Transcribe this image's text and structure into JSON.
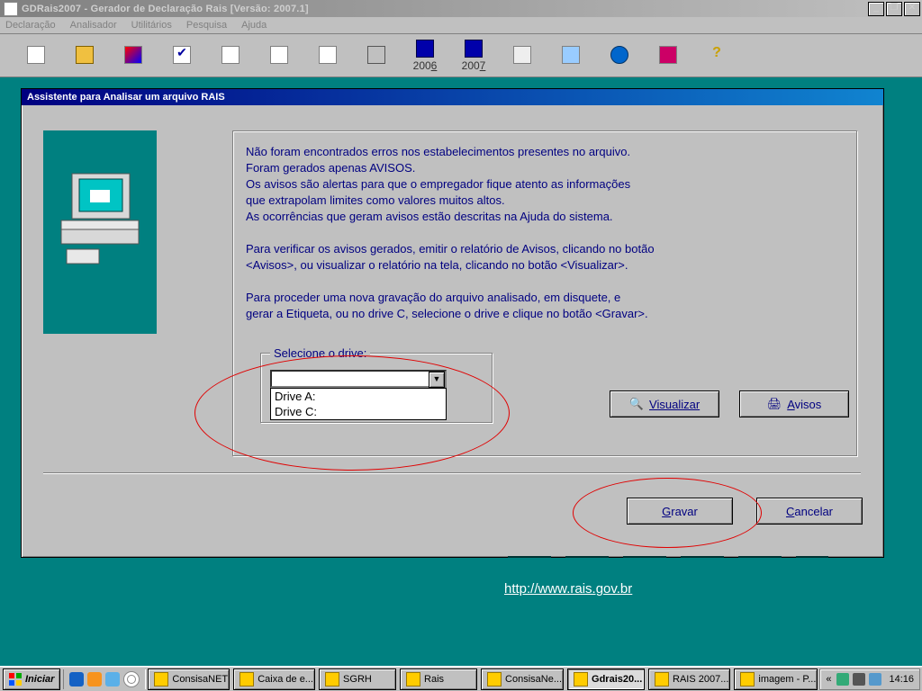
{
  "window": {
    "title": "GDRais2007 - Gerador de Declaração Rais [Versão: 2007.1]",
    "min": "_",
    "max": "❐",
    "close": "✕"
  },
  "menu": {
    "declaracao": "Declaração",
    "analisador": "Analisador",
    "utilitarios": "Utilitários",
    "pesquisa": "Pesquisa",
    "ajuda": "Ajuda"
  },
  "toolbar": {
    "year1": "2006",
    "year2": "2007"
  },
  "dialog": {
    "title": "Assistente para Analisar um arquivo RAIS",
    "line1": "Não foram encontrados erros nos estabelecimentos presentes no arquivo.",
    "line2": "Foram gerados apenas AVISOS.",
    "line3": "Os avisos são alertas para que o empregador fique atento as informações",
    "line4": " que extrapolam limites como valores muitos altos.",
    "line5": "As ocorrências que geram avisos estão descritas na Ajuda do sistema.",
    "line6": "Para verificar os avisos gerados,  emitir o relatório de Avisos, clicando no botão",
    "line7": "<Avisos>, ou visualizar o relatório na tela,  clicando no botão <Visualizar>.",
    "line8": "Para proceder uma nova gravação do arquivo analisado, em disquete, e",
    "line9": "gerar a Etiqueta, ou no drive C, selecione o drive e clique no botão <Gravar>.",
    "drive_label": "Selecione o drive:",
    "drive_options": {
      "a": "Drive A:",
      "c": "Drive C:"
    },
    "btn_visualizar": "Visualizar",
    "btn_avisos": "Avisos",
    "btn_gravar": "Gravar",
    "btn_cancelar": "Cancelar"
  },
  "link": "http://www.rais.gov.br",
  "taskbar": {
    "start": "Iniciar",
    "tasks": {
      "t0": "ConsisaNET",
      "t1": "Caixa de e...",
      "t2": "SGRH",
      "t3": "Rais",
      "t4": "ConsisaNe...",
      "t5": "Gdrais20...",
      "t6": "RAIS 2007...",
      "t7": "imagem - P..."
    },
    "tray_chevron": "«",
    "clock": "14:16"
  }
}
